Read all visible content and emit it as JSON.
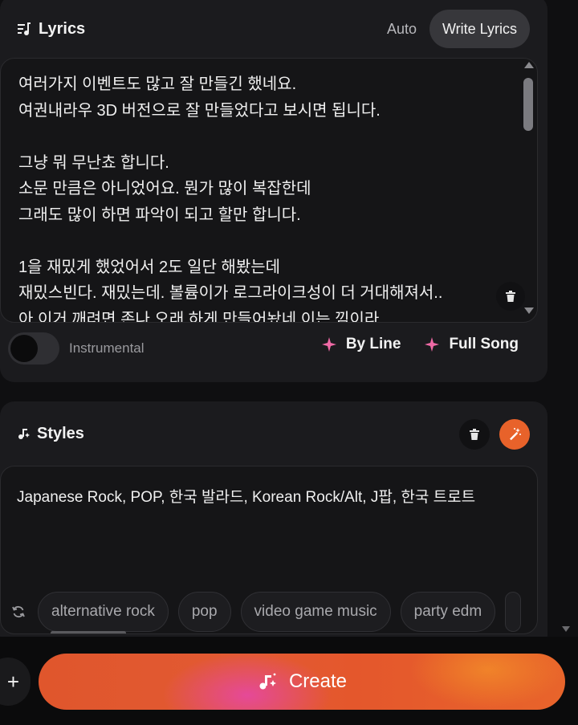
{
  "lyrics": {
    "title": "Lyrics",
    "tab_auto": "Auto",
    "tab_write": "Write Lyrics",
    "text": "여러가지 이벤트도 많고 잘 만들긴 했네요.\n여권내라우 3D 버전으로 잘 만들었다고 보시면 됩니다.\n\n그냥 뭐 무난쵸 합니다.\n소문 만큼은 아니었어요. 뭔가 많이 복잡한데\n그래도 많이 하면 파악이 되고 할만 합니다.\n\n1을 재밌게 했었어서 2도 일단 해봤는데\n재밌스빈다. 재밌는데. 볼륨이가 로그라이크성이 더 거대해져서..\n아 이거 깨려면 존나 오래 하게 만들어놨네 이는 낌이라",
    "instrumental_label": "Instrumental",
    "by_line_label": "By Line",
    "full_song_label": "Full Song"
  },
  "styles": {
    "title": "Styles",
    "text": "Japanese Rock, POP, 한국 발라드, Korean Rock/Alt, J팝, 한국 트로트",
    "suggestions": [
      "alternative rock",
      "pop",
      "video game music",
      "party edm"
    ]
  },
  "create_label": "Create",
  "plus_label": "+",
  "colors": {
    "accent_pink": "#f06aa6",
    "accent_orange": "#e8622a",
    "card_bg": "#1b1b1e"
  }
}
